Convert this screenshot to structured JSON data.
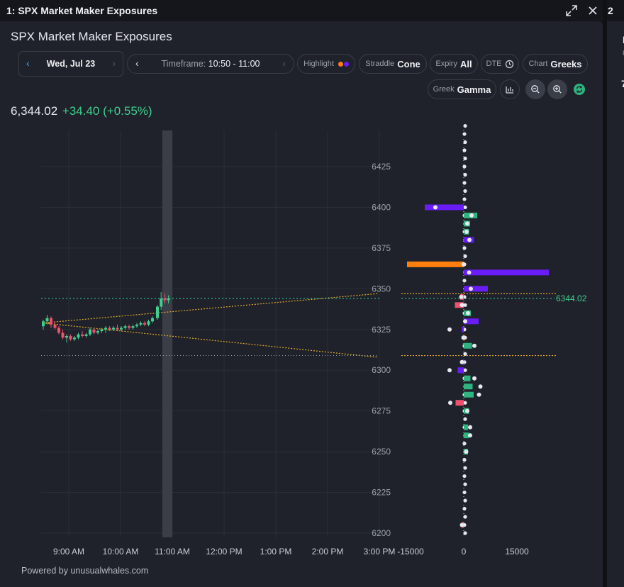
{
  "window": {
    "title": "1: SPX Market Maker Exposures",
    "side_title": "2",
    "side_letters": [
      "I",
      "F",
      "7"
    ]
  },
  "header": {
    "title": "SPX Market Maker Exposures"
  },
  "toolbar": {
    "date": "Wed, Jul 23",
    "timeframe_label": "Timeframe:",
    "timeframe_value": "10:50 - 11:00",
    "highlight_label": "Highlight",
    "straddle_label": "Straddle",
    "straddle_value": "Cone",
    "expiry_label": "Expiry",
    "expiry_value": "All",
    "dte_label": "DTE",
    "chart_label": "Chart",
    "chart_value": "Greeks",
    "greek_label": "Greek",
    "greek_value": "Gamma"
  },
  "quote": {
    "price": "6,344.02",
    "change": "+34.40 (+0.55%)"
  },
  "footer": {
    "powered_by": "Powered by unusualwhales.com"
  },
  "colors": {
    "green": "#3fcf8e",
    "red": "#f0506e",
    "purple": "#6a1cf6",
    "orange": "#ff7f0e",
    "teal_bar": "#2fb380",
    "cone": "#e3a92a",
    "current_line": "#2ec4a0"
  },
  "chart_data": [
    {
      "type": "candlestick",
      "x_ticks": [
        "9:00 AM",
        "10:00 AM",
        "11:00 AM",
        "12:00 PM",
        "1:00 PM",
        "2:00 PM",
        "3:00 PM"
      ],
      "y_ticks": [
        6200,
        6225,
        6250,
        6275,
        6300,
        6325,
        6350,
        6375,
        6400,
        6425
      ],
      "ylim": [
        6198,
        6452
      ],
      "grid": true,
      "current_price": 6344.02,
      "current_price_label": "6344.02",
      "cone_upper_end": 6347,
      "cone_lower_end": 6308,
      "cone_start": 6329,
      "lower_reference": 6309,
      "highlight_window": "10:50 - 11:00",
      "candles": [
        {
          "o": 6327,
          "h": 6331,
          "l": 6325,
          "c": 6330
        },
        {
          "o": 6330,
          "h": 6334,
          "l": 6328,
          "c": 6332
        },
        {
          "o": 6332,
          "h": 6333,
          "l": 6326,
          "c": 6328
        },
        {
          "o": 6328,
          "h": 6330,
          "l": 6325,
          "c": 6326
        },
        {
          "o": 6326,
          "h": 6327,
          "l": 6322,
          "c": 6323
        },
        {
          "o": 6323,
          "h": 6325,
          "l": 6319,
          "c": 6320
        },
        {
          "o": 6320,
          "h": 6322,
          "l": 6317,
          "c": 6321
        },
        {
          "o": 6321,
          "h": 6322,
          "l": 6318,
          "c": 6319
        },
        {
          "o": 6319,
          "h": 6321,
          "l": 6318,
          "c": 6320
        },
        {
          "o": 6320,
          "h": 6323,
          "l": 6319,
          "c": 6322
        },
        {
          "o": 6322,
          "h": 6324,
          "l": 6320,
          "c": 6321
        },
        {
          "o": 6321,
          "h": 6323,
          "l": 6320,
          "c": 6322
        },
        {
          "o": 6322,
          "h": 6326,
          "l": 6321,
          "c": 6325
        },
        {
          "o": 6325,
          "h": 6326,
          "l": 6322,
          "c": 6323
        },
        {
          "o": 6323,
          "h": 6325,
          "l": 6322,
          "c": 6324
        },
        {
          "o": 6324,
          "h": 6326,
          "l": 6323,
          "c": 6325
        },
        {
          "o": 6325,
          "h": 6327,
          "l": 6323,
          "c": 6326
        },
        {
          "o": 6326,
          "h": 6327,
          "l": 6324,
          "c": 6325
        },
        {
          "o": 6325,
          "h": 6327,
          "l": 6324,
          "c": 6326
        },
        {
          "o": 6326,
          "h": 6328,
          "l": 6324,
          "c": 6325
        },
        {
          "o": 6325,
          "h": 6327,
          "l": 6324,
          "c": 6326
        },
        {
          "o": 6326,
          "h": 6328,
          "l": 6325,
          "c": 6327
        },
        {
          "o": 6327,
          "h": 6328,
          "l": 6325,
          "c": 6326
        },
        {
          "o": 6326,
          "h": 6328,
          "l": 6325,
          "c": 6327
        },
        {
          "o": 6327,
          "h": 6329,
          "l": 6326,
          "c": 6328
        },
        {
          "o": 6328,
          "h": 6330,
          "l": 6327,
          "c": 6329
        },
        {
          "o": 6329,
          "h": 6330,
          "l": 6327,
          "c": 6328
        },
        {
          "o": 6328,
          "h": 6331,
          "l": 6327,
          "c": 6330
        },
        {
          "o": 6330,
          "h": 6333,
          "l": 6329,
          "c": 6332
        },
        {
          "o": 6332,
          "h": 6340,
          "l": 6331,
          "c": 6339
        },
        {
          "o": 6339,
          "h": 6348,
          "l": 6337,
          "c": 6344
        },
        {
          "o": 6344,
          "h": 6347,
          "l": 6341,
          "c": 6343
        },
        {
          "o": 6343,
          "h": 6346,
          "l": 6341,
          "c": 6344
        }
      ]
    },
    {
      "type": "bar",
      "orientation": "horizontal",
      "x_ticks": [
        "-15000",
        "0",
        "15000"
      ],
      "xlim": [
        -18000,
        27000
      ],
      "strike_step": 5,
      "bars": [
        {
          "strike": 6400,
          "value": -11000,
          "color": "purple",
          "dot": -8000
        },
        {
          "strike": 6395,
          "value": 3800,
          "color": "teal",
          "dot": 2200
        },
        {
          "strike": 6390,
          "value": 1800,
          "color": "teal",
          "dot": 1000
        },
        {
          "strike": 6385,
          "value": 1500,
          "color": "teal",
          "dot": 800
        },
        {
          "strike": 6380,
          "value": 2800,
          "color": "purple",
          "dot": 1600
        },
        {
          "strike": 6365,
          "value": -16000,
          "color": "orange",
          "dot": 0
        },
        {
          "strike": 6360,
          "value": 24000,
          "color": "purple",
          "dot": 1500
        },
        {
          "strike": 6350,
          "value": 6800,
          "color": "purple",
          "dot": 2000
        },
        {
          "strike": 6345,
          "value": -1000,
          "color": "red",
          "dot": -700
        },
        {
          "strike": 6340,
          "value": -2500,
          "color": "red",
          "dot": -500
        },
        {
          "strike": 6335,
          "value": 2000,
          "color": "teal",
          "dot": 1200
        },
        {
          "strike": 6330,
          "value": 4200,
          "color": "purple",
          "dot": 400
        },
        {
          "strike": 6325,
          "value": -600,
          "color": "purple",
          "dot": -4000
        },
        {
          "strike": 6320,
          "value": -100,
          "color": "orange",
          "dot": -100
        },
        {
          "strike": 6315,
          "value": 2300,
          "color": "teal",
          "dot": 3000
        },
        {
          "strike": 6305,
          "value": -300,
          "color": "purple",
          "dot": -500
        },
        {
          "strike": 6300,
          "value": -1700,
          "color": "purple",
          "dot": -4000
        },
        {
          "strike": 6295,
          "value": 1900,
          "color": "teal",
          "dot": 3000
        },
        {
          "strike": 6290,
          "value": 2500,
          "color": "teal",
          "dot": 4700
        },
        {
          "strike": 6285,
          "value": 2800,
          "color": "teal",
          "dot": 4300
        },
        {
          "strike": 6280,
          "value": -2300,
          "color": "red",
          "dot": -3800
        },
        {
          "strike": 6275,
          "value": 1500,
          "color": "teal",
          "dot": 1000
        },
        {
          "strike": 6265,
          "value": 1200,
          "color": "teal",
          "dot": 1800
        },
        {
          "strike": 6260,
          "value": 1500,
          "color": "teal",
          "dot": 1800
        },
        {
          "strike": 6250,
          "value": 1200,
          "color": "teal",
          "dot": 700
        },
        {
          "strike": 6205,
          "value": -500,
          "color": "red",
          "dot": -500
        }
      ]
    }
  ]
}
